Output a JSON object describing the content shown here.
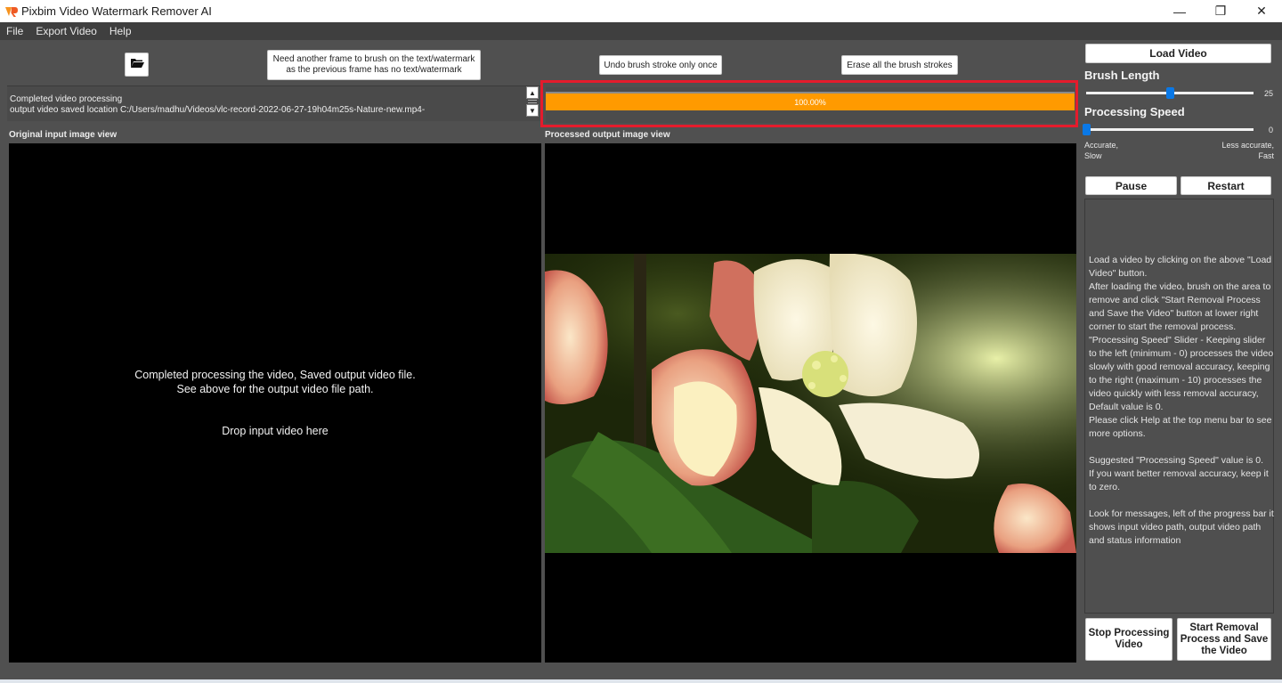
{
  "window": {
    "title": "Pixbim Video Watermark Remover AI",
    "logo_icon": "pixbim-logo-icon",
    "controls": {
      "minimize": "—",
      "restore": "❐",
      "close": "✕"
    }
  },
  "menu": [
    "File",
    "Export Video",
    "Help"
  ],
  "toolbar": {
    "open_folder_icon": "folder-open-icon",
    "need_frame_label": "Need another frame to brush on the text/watermark as the previous frame has no text/watermark",
    "undo_label": "Undo brush stroke only once",
    "erase_label": "Erase all the brush strokes"
  },
  "status": {
    "line1": "Completed video processing",
    "line2": "output video saved location C:/Users/madhu/Videos/vlc-record-2022-06-27-19h04m25s-Nature-new.mp4-",
    "scroll_up": "▲",
    "scroll_down": "▼"
  },
  "progress": {
    "percent": 100,
    "label": "100.00%",
    "color": "#ff9a00",
    "highlight_color": "#e51b2c"
  },
  "views": {
    "input_label": "Original input image view",
    "output_label": "Processed output image view",
    "input_message_line1": "Completed processing the video, Saved output video file.",
    "input_message_line2": "See above for the output video file path.",
    "drop_message": "Drop input video here",
    "output_frame": "processed video frame: close-up of pink and white apple blossom with green leaves"
  },
  "right_panel": {
    "load_video_label": "Load Video",
    "brush_length": {
      "label": "Brush Length",
      "value": 25,
      "min": 0,
      "max": 50
    },
    "processing_speed": {
      "label": "Processing Speed",
      "value": 0,
      "min": 0,
      "max": 10
    },
    "speed_left_caption_1": "Accurate,",
    "speed_left_caption_2": "Slow",
    "speed_right_caption_1": "Less accurate,",
    "speed_right_caption_2": "Fast",
    "pause_label": "Pause",
    "restart_label": "Restart",
    "help_text": "Load a video by clicking on the above \"Load Video\" button.\nAfter loading the video, brush on the area to remove and click \"Start Removal Process and Save the Video\" button at lower right corner to start the removal process.\n\"Processing Speed\" Slider - Keeping slider to the left (minimum - 0) processes the video slowly with good removal accuracy, keeping to the right (maximum - 10) processes the video quickly with less removal accuracy, Default value is 0.\nPlease click Help at the top menu bar to see more options.\n\nSuggested \"Processing Speed\" value is 0.\nIf you want better removal accuracy, keep it to zero.\n\nLook for messages, left of the progress bar it shows input video path, output video path and status information",
    "stop_label": "Stop Processing Video",
    "start_label": "Start Removal Process and Save the Video",
    "slider_color": "#0a78e6"
  }
}
